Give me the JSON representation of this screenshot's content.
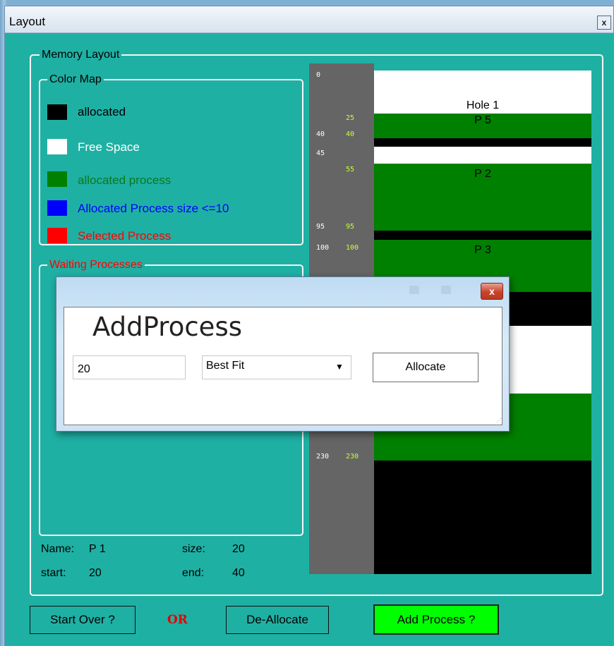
{
  "window": {
    "title": "Layout",
    "close": "x"
  },
  "memory_layout": {
    "label": "Memory Layout"
  },
  "color_map": {
    "label": "Color Map",
    "items": [
      {
        "text": "allocated",
        "swatch": "#000000",
        "text_color": "#000000"
      },
      {
        "text": "Free Space",
        "swatch": "#ffffff",
        "text_color": "#ffffff"
      },
      {
        "text": "allocated process",
        "swatch": "#008000",
        "text_color": "#0a7a1a"
      },
      {
        "text": "Allocated Process size <=10",
        "swatch": "#0000ff",
        "text_color": "#0000ff"
      },
      {
        "text": "Selected Process",
        "swatch": "#ff0000",
        "text_color": "#ff0000"
      }
    ]
  },
  "waiting": {
    "label": "Waiting Processes"
  },
  "info": {
    "name_label": "Name:",
    "name_value": "P 1",
    "size_label": "size:",
    "size_value": "20",
    "start_label": "start:",
    "start_value": "20",
    "end_label": "end:",
    "end_value": "40"
  },
  "memory": {
    "addresses": [
      {
        "left": "0"
      },
      {
        "right": "25"
      },
      {
        "left": "40",
        "right": "40"
      },
      {
        "left": "45"
      },
      {
        "right": "55"
      },
      {
        "left": "95",
        "right": "95"
      },
      {
        "left": "100",
        "right": "100"
      },
      {
        "left": "230",
        "right": "230"
      }
    ],
    "labels": [
      "Hole 1",
      "P 5",
      "P 2",
      "P 3"
    ],
    "colors": {
      "allocated": "#000000",
      "free": "#ffffff",
      "process": "#008000",
      "address_left": "#ffffff",
      "address_right": "#c6ff33"
    }
  },
  "buttons": {
    "start_over": "Start Over ?",
    "or": "OR",
    "deallocate": "De-Allocate",
    "add_process": "Add Process ?"
  },
  "dialog": {
    "title": "AddProcess",
    "close": "x",
    "size_value": "20",
    "fit_value": "Best Fit",
    "allocate": "Allocate"
  }
}
